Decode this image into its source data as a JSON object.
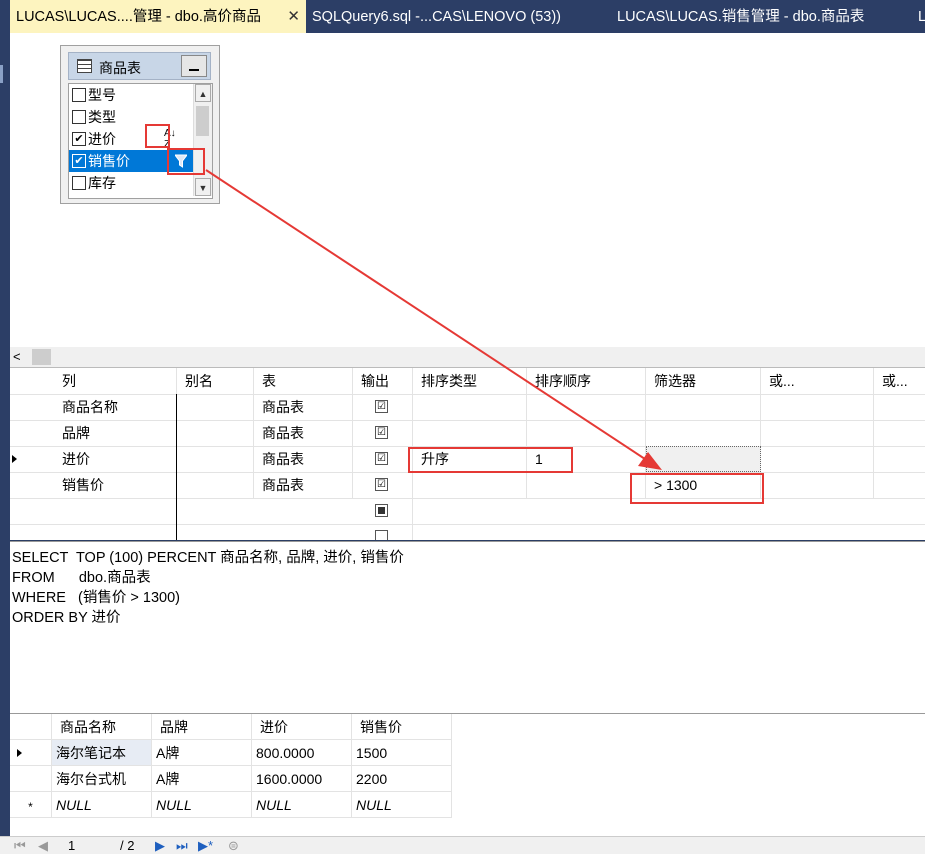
{
  "tabs": [
    {
      "label": "LUCAS\\LUCAS....管理 - dbo.高价商品",
      "close": "✕"
    },
    {
      "label": "SQLQuery6.sql -...CAS\\LENOVO (53))"
    },
    {
      "label": "LUCAS\\LUCAS.销售管理 - dbo.商品表"
    },
    {
      "label": "L"
    }
  ],
  "diagram": {
    "table_title": "商品表",
    "columns": [
      {
        "label": "型号",
        "checked": ""
      },
      {
        "label": "类型",
        "checked": ""
      },
      {
        "label": "进价",
        "checked": "✔"
      },
      {
        "label": "销售价",
        "checked": "✔"
      },
      {
        "label": "库存",
        "checked": ""
      }
    ],
    "sort_icon_top": "A",
    "sort_icon_bottom": "Z"
  },
  "hscroll": {
    "arrow": "<"
  },
  "criteria": {
    "headers": [
      "列",
      "别名",
      "表",
      "输出",
      "排序类型",
      "排序顺序",
      "筛选器",
      "或...",
      "或..."
    ],
    "rows": [
      {
        "column": "商品名称",
        "alias": "",
        "table": "商品表",
        "output": "☑",
        "sort_type": "",
        "sort_order": "",
        "filter": ""
      },
      {
        "column": "品牌",
        "alias": "",
        "table": "商品表",
        "output": "☑",
        "sort_type": "",
        "sort_order": "",
        "filter": ""
      },
      {
        "column": "进价",
        "alias": "",
        "table": "商品表",
        "output": "☑",
        "sort_type": "升序",
        "sort_order": "1",
        "filter": ""
      },
      {
        "column": "销售价",
        "alias": "",
        "table": "商品表",
        "output": "☑",
        "sort_type": "",
        "sort_order": "",
        "filter": "> 1300"
      }
    ]
  },
  "sql": {
    "lines": [
      "SELECT  TOP (100) PERCENT 商品名称, 品牌, 进价, 销售价",
      "FROM      dbo.商品表",
      "WHERE   (销售价 > 1300)",
      "ORDER BY 进价"
    ]
  },
  "results": {
    "headers": [
      "商品名称",
      "品牌",
      "进价",
      "销售价"
    ],
    "rows": [
      [
        "海尔笔记本",
        "A牌",
        "800.0000",
        "1500"
      ],
      [
        "海尔台式机",
        "A牌",
        "1600.0000",
        "2200"
      ],
      [
        "NULL",
        "NULL",
        "NULL",
        "NULL"
      ]
    ],
    "new_row_marker": "*"
  },
  "navbar": {
    "page": "1",
    "of": "/ 2"
  },
  "colors": {
    "highlight_red": "#e53935",
    "selection_blue": "#0078d7",
    "active_tab": "#fdf4bf",
    "chrome": "#2c3e66"
  }
}
